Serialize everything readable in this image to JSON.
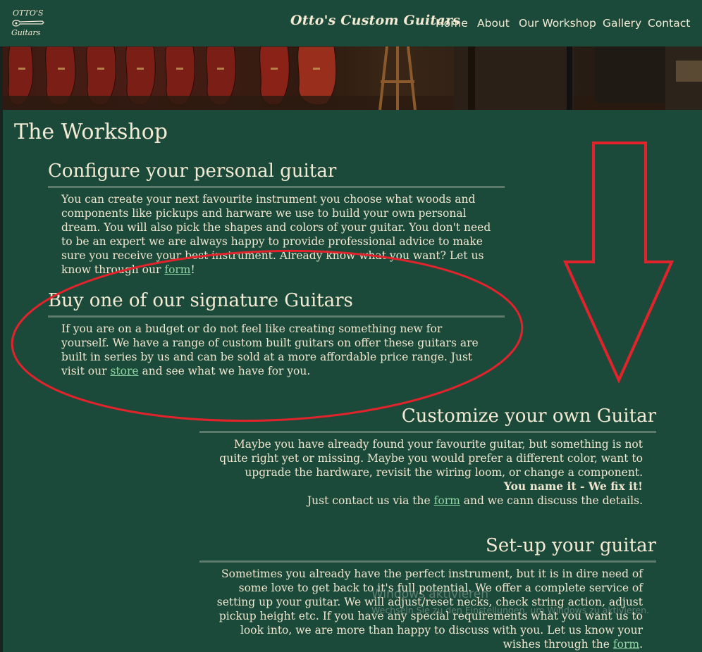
{
  "header": {
    "logo_line1": "OTTO'S",
    "logo_line2": "Guitars",
    "brand": "Otto's Custom Guitars",
    "nav": [
      "Home",
      "About",
      "Our Workshop",
      "Gallery",
      "Contact"
    ]
  },
  "page_title": "The Workshop",
  "sections": [
    {
      "heading": "Configure your personal guitar",
      "text_before": "You can create your next favourite instrument you choose what woods and components like pickups and harware we use to build your own personal dream. You will also pick the shapes and colors of your guitar. You don't need to be an expert we are always happy to provide professional advice to make sure you receive your best instrument. Already know what you want? Let us know through our ",
      "link": "form",
      "text_after": "!"
    },
    {
      "heading": "Buy one of our signature Guitars",
      "text_before": "If you are on a budget or do not feel like creating something new for yourself. We have a range of custom built guitars on offer these guitars are built in series by us and can be sold at a more affordable price range. Just visit our ",
      "link": "store",
      "text_after": " and see what we have for you."
    },
    {
      "heading": "Customize your own Guitar",
      "text_before": "Maybe you have already found your favourite guitar, but something is not quite right yet or missing. Maybe you would prefer a different color, want to upgrade the hardware, revisit the wiring loom, or change a component.",
      "bold_line": "You name it - We fix it!",
      "line3_before": "Just contact us via the ",
      "link": "form",
      "text_after": " and we cann discuss the details."
    },
    {
      "heading": "Set-up your guitar",
      "text_before": "Sometimes you already have the perfect instrument, but it is in dire need of some love to get back to it's full potential. We offer a complete service of setting up your guitar. We will adjust/reset necks, check string action, adjust pickup height etc. If you have any special requirements what you want us to look into, we are more than happy to discuss with you. Let us know your wishes through the ",
      "link": "form",
      "text_after": "."
    }
  ],
  "watermark": {
    "line1": "Windows aktivieren",
    "line2": "Wechseln Sie zu den Einstellungen, um Windows zu aktivieren."
  },
  "colors": {
    "background": "#1c4a3a",
    "text": "#efe6cf",
    "link": "#8fd4a4",
    "annotation": "#e3232b"
  }
}
